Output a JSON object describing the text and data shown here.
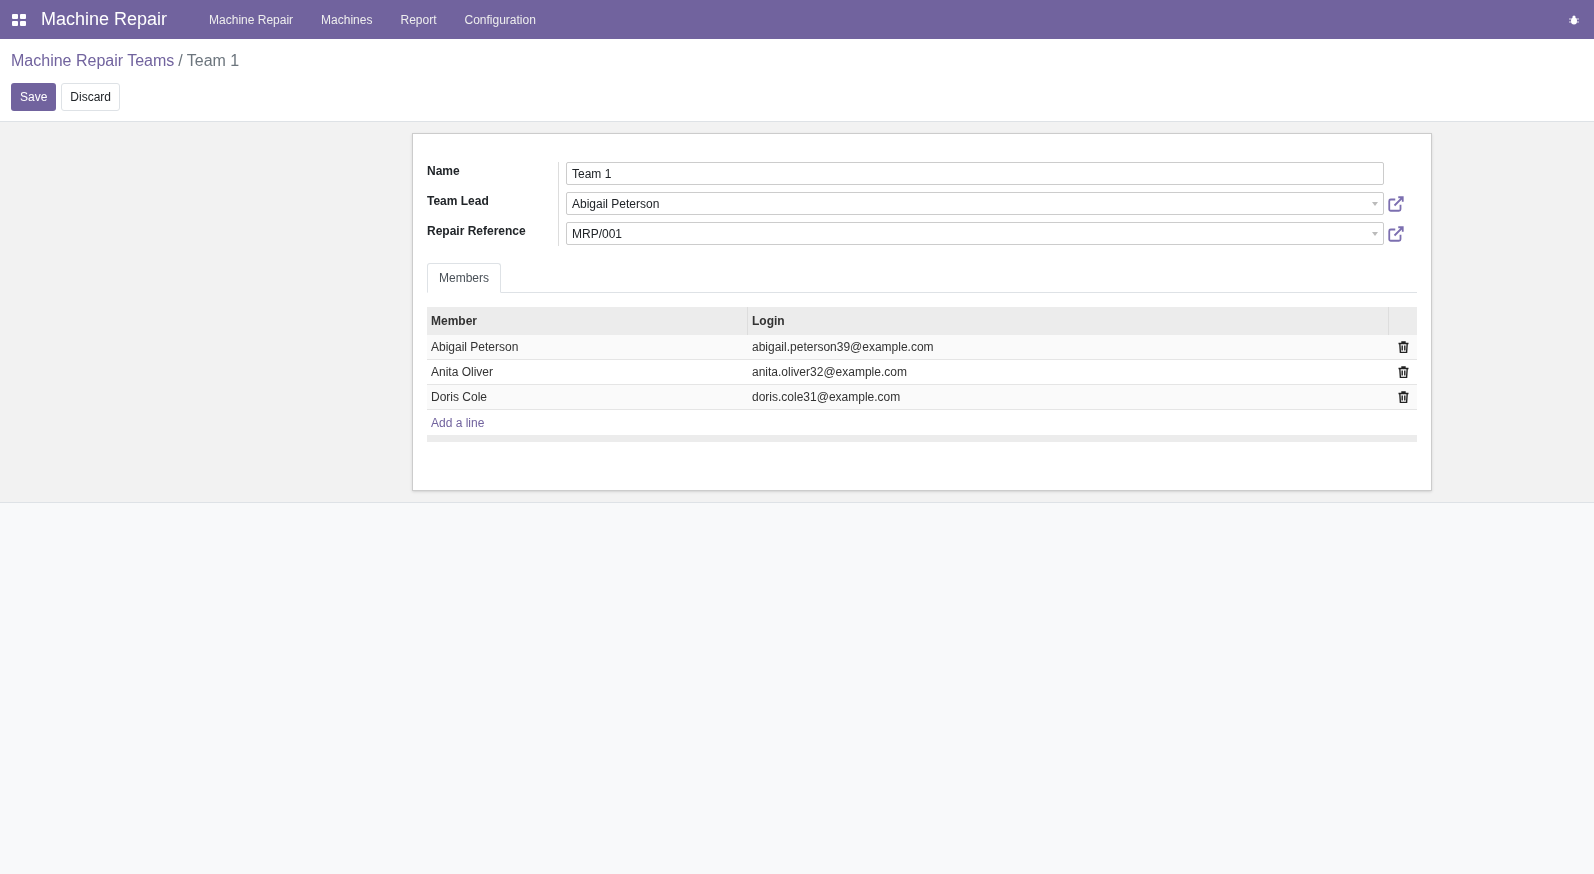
{
  "navbar": {
    "app_title": "Machine Repair",
    "menu": [
      "Machine Repair",
      "Machines",
      "Report",
      "Configuration"
    ]
  },
  "breadcrumb": {
    "parent": "Machine Repair Teams",
    "separator": "/",
    "current": "Team 1"
  },
  "buttons": {
    "save": "Save",
    "discard": "Discard"
  },
  "fields": [
    {
      "label": "Name",
      "value": "Team 1",
      "kind": "text"
    },
    {
      "label": "Team Lead",
      "value": "Abigail Peterson",
      "kind": "many2one"
    },
    {
      "label": "Repair Reference",
      "value": "MRP/001",
      "kind": "many2one"
    }
  ],
  "tabs": [
    {
      "label": "Members",
      "selected": true
    }
  ],
  "table": {
    "columns": [
      "Member",
      "Login"
    ],
    "rows": [
      {
        "member": "Abigail Peterson",
        "login": "abigail.peterson39@example.com"
      },
      {
        "member": "Anita Oliver",
        "login": "anita.oliver32@example.com"
      },
      {
        "member": "Doris Cole",
        "login": "doris.cole31@example.com"
      }
    ],
    "add_line": "Add a line"
  }
}
